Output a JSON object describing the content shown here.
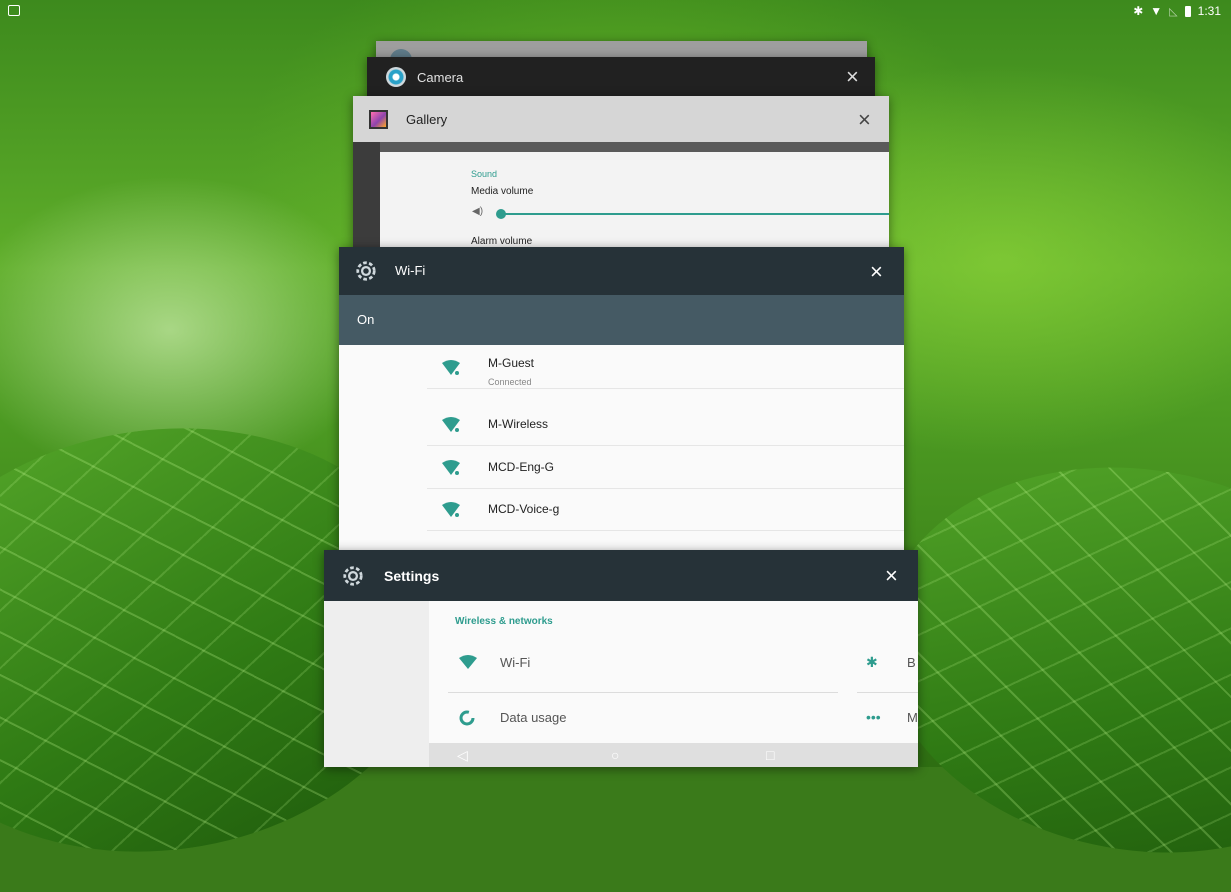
{
  "status_bar": {
    "time": "1:31",
    "bluetooth_icon": "bluetooth-icon",
    "wifi_icon": "wifi-icon",
    "battery_icon": "battery-icon"
  },
  "cards": {
    "camera": {
      "title": "Camera"
    },
    "gallery": {
      "title": "Gallery",
      "section": "Sound",
      "media_volume": "Media volume",
      "media_volume_level": 1.0,
      "alarm_volume": "Alarm volume"
    },
    "wifi": {
      "title": "Wi-Fi",
      "state": "On",
      "networks": [
        {
          "name": "M-Guest",
          "status": "Connected"
        },
        {
          "name": "M-Wireless",
          "status": ""
        },
        {
          "name": "MCD-Eng-G",
          "status": ""
        },
        {
          "name": "MCD-Voice-g",
          "status": ""
        }
      ]
    },
    "settings": {
      "title": "Settings",
      "section": "Wireless & networks",
      "rows": [
        {
          "label": "Wi-Fi",
          "icon": "wifi-icon"
        },
        {
          "label": "Data usage",
          "icon": "data-usage-icon"
        }
      ],
      "right_rows": [
        {
          "label": "B",
          "icon": "bluetooth-icon"
        },
        {
          "label": "M",
          "icon": "more-icon"
        }
      ]
    }
  },
  "nav": {
    "back": "◁",
    "home": "○",
    "recents": "□"
  },
  "colors": {
    "accent": "#2e9c8e",
    "toolbar": "#263238",
    "subbar": "#455a64"
  }
}
